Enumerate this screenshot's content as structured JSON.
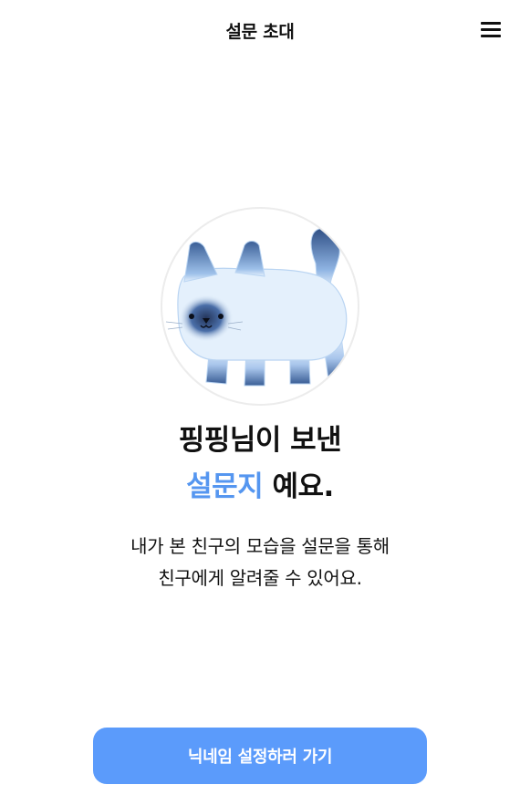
{
  "header": {
    "title": "설문 초대",
    "menu_icon": "hamburger-menu-icon"
  },
  "illustration": {
    "name": "siamese-cat-illustration",
    "colors": {
      "body": "#e4f0fc",
      "outline": "#b9d4f2",
      "points": "#3a5e96"
    }
  },
  "headline": {
    "line1": "핑핑님이 보낸",
    "accent": "설문지",
    "line2_rest": " 예요."
  },
  "description": {
    "line1": "내가 본 친구의 모습을 설문을 통해",
    "line2": "친구에게 알려줄 수 있어요."
  },
  "cta": {
    "label": "닉네임 설정하러 가기"
  },
  "colors": {
    "accent": "#5596f0",
    "button": "#5b9bfb",
    "text": "#111111",
    "background": "#ffffff"
  }
}
